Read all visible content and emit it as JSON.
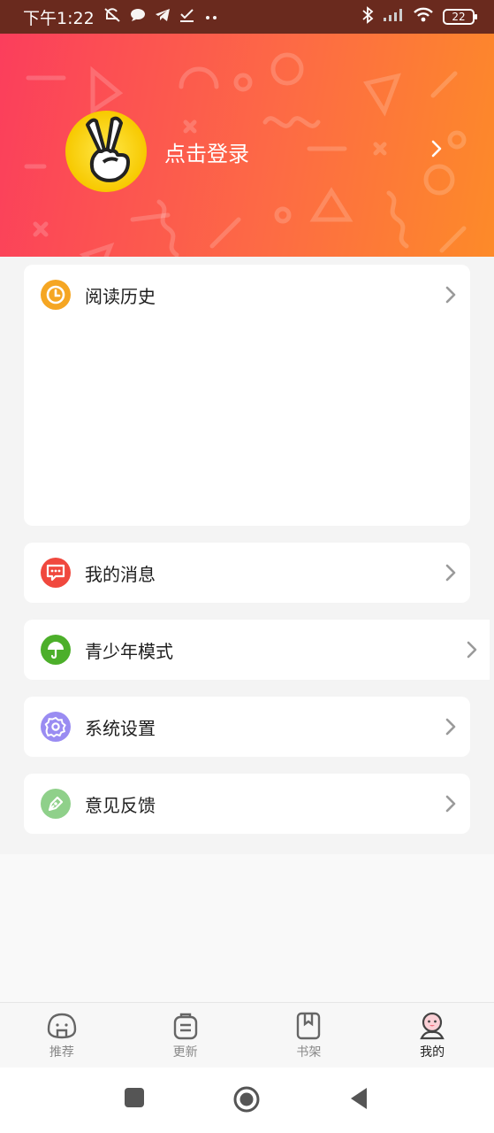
{
  "status_bar": {
    "time": "下午1:22",
    "left_icons": [
      "mute-icon",
      "chat-bubble-icon",
      "telegram-icon",
      "download-check-icon",
      "more-dots-icon"
    ],
    "right_icons": [
      "bluetooth-icon",
      "signal-icon",
      "wifi-icon"
    ],
    "battery": "22"
  },
  "profile": {
    "login_text": "点击登录",
    "avatar_icon": "victory-hand-icon",
    "chevron_icon": "chevron-right-icon"
  },
  "menu": {
    "history": {
      "label": "阅读历史",
      "icon": "clock-icon",
      "color": "#f5a623"
    },
    "messages": {
      "label": "我的消息",
      "icon": "message-icon",
      "color": "#f0483e"
    },
    "teen_mode": {
      "label": "青少年模式",
      "icon": "umbrella-icon",
      "color": "#4caf2a"
    },
    "settings": {
      "label": "系统设置",
      "icon": "gear-icon",
      "color": "#9a8cf2"
    },
    "feedback": {
      "label": "意见反馈",
      "icon": "pen-icon",
      "color": "#8fd08a"
    }
  },
  "tabbar": {
    "tabs": [
      {
        "label": "推荐",
        "icon": "rice-ball-icon"
      },
      {
        "label": "更新",
        "icon": "bag-icon"
      },
      {
        "label": "书架",
        "icon": "book-icon"
      },
      {
        "label": "我的",
        "icon": "profile-face-icon"
      }
    ],
    "active_index": 3
  },
  "nav": {
    "buttons": [
      "square-recent-icon",
      "circle-home-icon",
      "triangle-back-icon"
    ]
  },
  "colors": {
    "hero_start": "#fb3e5c",
    "hero_end": "#fd8b28",
    "status_bar": "#6a2a1e",
    "page_bg": "#f4f4f4"
  }
}
